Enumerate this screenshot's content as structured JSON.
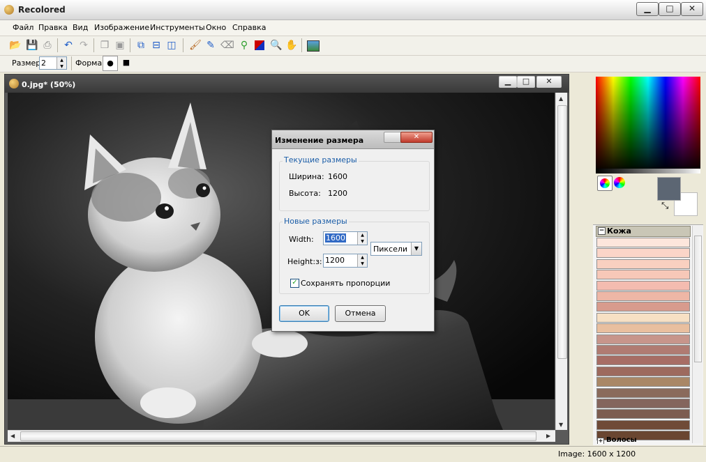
{
  "app": {
    "title": "Recolored"
  },
  "window_controls": {
    "minimize": "▁",
    "maximize": "□",
    "close": "✕"
  },
  "menu": [
    "Файл",
    "Правка",
    "Вид",
    "Изображение",
    "Инструменты",
    "Окно",
    "Справка"
  ],
  "toolbar": {
    "icons": [
      "open-folder-icon",
      "save-icon",
      "print-icon",
      "undo-icon",
      "redo-icon",
      "copy-icon",
      "paste-icon",
      "layers-icon",
      "split-horizontal-icon",
      "split-vertical-icon",
      "brush-icon",
      "pen-icon",
      "eraser-icon",
      "eyedropper-icon",
      "recolor-icon",
      "zoom-icon",
      "hand-icon",
      "image-icon"
    ]
  },
  "toolbar2": {
    "size_label": "Размер",
    "size_value": "2",
    "shape_label": "Форма",
    "shape_round": "●",
    "shape_square": "■"
  },
  "document": {
    "title": "0.jpg* (50%)"
  },
  "dialog": {
    "title": "Изменение размера",
    "current_group": "Текущие размеры",
    "width_label": "Ширина:",
    "width_value": "1600",
    "height_label": "Высота:",
    "height_value": "1200",
    "new_group": "Новые размеры",
    "new_width_label": "Width:",
    "new_width_value": "1600",
    "new_height_label": "Height:з:",
    "new_height_value": "1200",
    "unit_value": "Пиксели",
    "keep_ratio_label": "Сохранять пропорции",
    "keep_ratio_checked": true,
    "ok_label": "OK",
    "cancel_label": "Отмена"
  },
  "swatches": {
    "group1_label": "Кожа",
    "group2_label": "Волосы",
    "skin_colors": [
      "#fde6dc",
      "#fbd5c8",
      "#f9d0c0",
      "#f7c8b8",
      "#f4bcb0",
      "#eeb7a6",
      "#d89b8d",
      "#f7e0c4",
      "#e9bf9f",
      "#c7958b",
      "#b07b72",
      "#a76d65",
      "#9d6a5e",
      "#a98766",
      "#8a6b5c",
      "#84655d",
      "#7c5c50",
      "#6f4b37",
      "#6a4631"
    ]
  },
  "colors": {
    "primary": "#5c6673",
    "secondary": "#ffffff"
  },
  "status": {
    "image_size": "Image: 1600 x 1200"
  }
}
